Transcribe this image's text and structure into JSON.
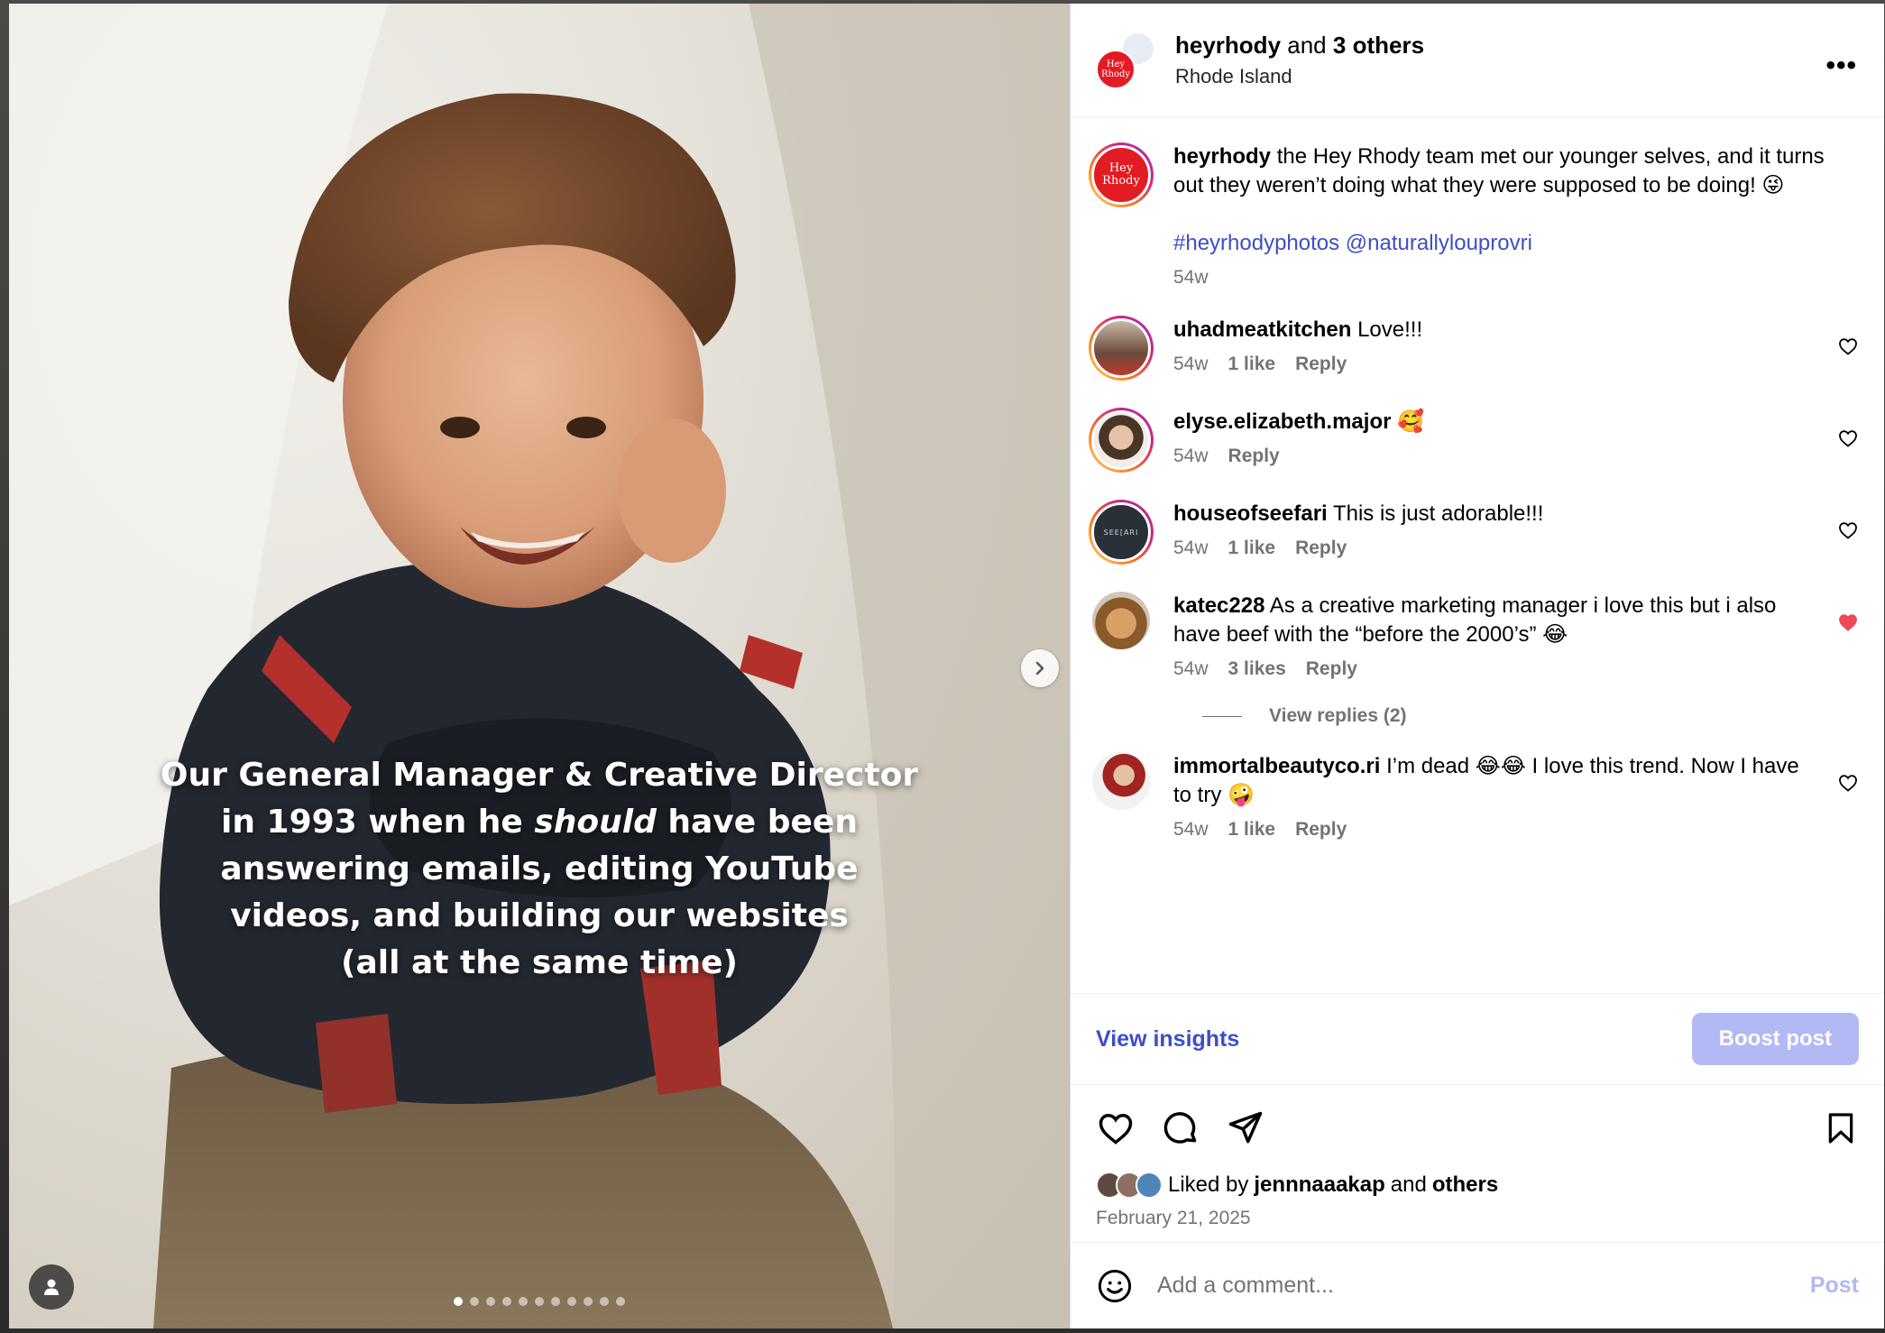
{
  "photo": {
    "overlay_line1": "Our General Manager & Creative Director",
    "overlay_line2_a": "in 1993 when he ",
    "overlay_line2_em": "should",
    "overlay_line2_b": " have been",
    "overlay_line3": "answering emails, editing YouTube",
    "overlay_line4": "videos, and building our websites",
    "overlay_line5": "(all at the same time)",
    "slide_count": 11,
    "active_slide": 1
  },
  "header": {
    "owner": "heyrhody",
    "and_text": "and",
    "others": "3 others",
    "location": "Rhode Island",
    "more": "•••",
    "logo_line1": "Hey",
    "logo_line2": "Rhody"
  },
  "caption": {
    "user": "heyrhody",
    "text": "the Hey Rhody team met our younger selves, and it turns out they weren’t doing what they were supposed to be doing! 😜",
    "tags": "#heyrhodyphotos @naturallylouprovri",
    "time": "54w"
  },
  "comments": [
    {
      "user": "uhadmeatkitchen",
      "text": "Love!!!",
      "time": "54w",
      "likes": "1 like",
      "reply": "Reply",
      "liked": false
    },
    {
      "user": "elyse.elizabeth.major",
      "text": "🥰",
      "time": "54w",
      "likes": "",
      "reply": "Reply",
      "liked": false
    },
    {
      "user": "houseofseefari",
      "text": "This is just adorable!!!",
      "time": "54w",
      "likes": "1 like",
      "reply": "Reply",
      "liked": false
    },
    {
      "user": "katec228",
      "text": "As a creative marketing manager i love this but i also have beef with the “before the 2000’s” 😂",
      "time": "54w",
      "likes": "3 likes",
      "reply": "Reply",
      "liked": true
    },
    {
      "user": "immortalbeautyco.ri",
      "text": "I’m dead 😂😂 I love this trend. Now I have to try 🤪",
      "time": "54w",
      "likes": "1 like",
      "reply": "Reply",
      "liked": false
    }
  ],
  "view_replies": "View replies (2)",
  "seefari_logo": "SEE[ARI",
  "insights": "View insights",
  "boost": "Boost post",
  "likes": {
    "prefix": "Liked by",
    "user": "jennnaaakap",
    "and_text": "and",
    "others": "others"
  },
  "date": "February 21, 2025",
  "comment_input": {
    "placeholder": "Add a comment..."
  },
  "post_button": "Post",
  "colors": {
    "link": "#3d4ec9",
    "boost_bg": "#b3b9f4",
    "liked_heart": "#ed4956",
    "brand_red": "#e31b23"
  }
}
